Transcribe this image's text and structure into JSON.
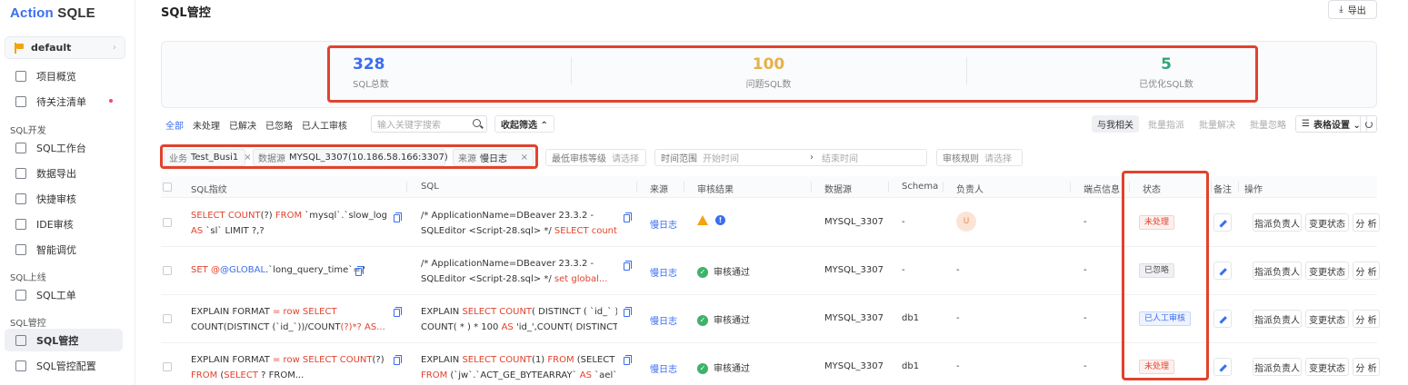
{
  "sidebar": {
    "brand_action": "Action",
    "brand_sqle": "SQLE",
    "project": "default",
    "items": [
      {
        "label": "项目概览"
      },
      {
        "label": "待关注清单"
      },
      {
        "label": "SQL工作台"
      },
      {
        "label": "数据导出"
      },
      {
        "label": "快捷审核"
      },
      {
        "label": "IDE审核"
      },
      {
        "label": "智能调优"
      },
      {
        "label": "SQL工单"
      },
      {
        "label": "SQL管控"
      },
      {
        "label": "SQL管控配置"
      }
    ],
    "groups": [
      "SQL开发",
      "SQL上线",
      "SQL管控"
    ]
  },
  "header": {
    "title": "SQL管控",
    "export_label": "导出"
  },
  "stats": [
    {
      "value": "328",
      "label": "SQL总数",
      "color": "#3a6df0"
    },
    {
      "value": "100",
      "label": "问题SQL数",
      "color": "#e6b14a"
    },
    {
      "value": "5",
      "label": "已优化SQL数",
      "color": "#2fa878"
    }
  ],
  "tabs": [
    "全部",
    "未处理",
    "已解决",
    "已忽略",
    "已人工审核"
  ],
  "search": {
    "placeholder": "输入关键字搜索"
  },
  "collapse_label": "收起筛选 ⌃",
  "tools": {
    "mine": "与我相关",
    "batch_assign": "批量指派",
    "batch_resolve": "批量解决",
    "batch_ignore": "批量忽略",
    "table_settings": "表格设置 ⌄"
  },
  "chips": [
    {
      "key": "业务",
      "value": "Test_Busi1"
    },
    {
      "key": "数据源",
      "value": "MYSQL_3307(10.186.58.166:3307)"
    },
    {
      "key": "来源",
      "value": "慢日志"
    }
  ],
  "filters": {
    "min_level_key": "最低审核等级",
    "min_level_placeholder": "请选择",
    "time_key": "时间范围",
    "time_start": "开始时间",
    "time_end": "结束时间",
    "arrow": "›",
    "rule_key": "审核规则",
    "rule_placeholder": "请选择"
  },
  "columns": {
    "fingerprint": "SQL指纹",
    "sql": "SQL",
    "source": "来源",
    "audit_result": "审核结果",
    "datasource": "数据源",
    "schema": "Schema",
    "owner": "负责人",
    "endpoint": "端点信息",
    "status": "状态",
    "remark": "备注",
    "actions": "操作"
  },
  "rows": [
    {
      "fp1_a": "SELECT COUNT",
      "fp1_b": "(?) ",
      "fp1_c": "FROM",
      "fp1_d": " `mysql`.`slow_log`",
      "fp2_a": "AS",
      "fp2_b": " `sl` LIMIT ?,?",
      "sql1": "/* ApplicationName=DBeaver 23.3.2 -",
      "sql2_a": "SQLEditor <Script-28.sql> */ ",
      "sql2_b": "SELECT count(*)...",
      "source": "慢日志",
      "audit": "",
      "datasource": "MYSQL_3307",
      "schema": "-",
      "owner": "U",
      "endpoint": "-",
      "status": "未处理",
      "status_kind": "red"
    },
    {
      "fp1_a": "SET @",
      "fp1_b": "@GLOBAL",
      "fp1_c": ".`long_query_time`=?",
      "sql1": "/* ApplicationName=DBeaver 23.3.2 -",
      "sql2_a": "SQLEditor <Script-28.sql> */ ",
      "sql2_b": "set global...",
      "source": "慢日志",
      "audit": "审核通过",
      "datasource": "MYSQL_3307",
      "schema": "-",
      "owner": "-",
      "endpoint": "-",
      "status": "已忽略",
      "status_kind": "gray"
    },
    {
      "fp1_a": "EXPLAIN FORMAT ",
      "fp1_b": "= row SELECT",
      "fp2_a": "COUNT",
      "fp2_b": "(DISTINCT (`id_`))/",
      "fp2_c": "COUNT",
      "fp2_d": "(?)*? AS...",
      "sql1_a": "EXPLAIN ",
      "sql1_b": "SELECT COUNT",
      "sql1_c": "( DISTINCT ( `id_` ) ) /",
      "sql2_a": "COUNT",
      "sql2_b": "( * ) * 100 ",
      "sql2_c": "AS",
      "sql2_d": " 'id_',COUNT( DISTINCT (...",
      "source": "慢日志",
      "audit": "审核通过",
      "datasource": "MYSQL_3307",
      "schema": "db1",
      "owner": "-",
      "endpoint": "-",
      "status": "已人工审核",
      "status_kind": "blue"
    },
    {
      "fp1_a": "EXPLAIN FORMAT ",
      "fp1_b": "= row SELECT COUNT",
      "fp1_c": "(?)",
      "fp2_a": "FROM",
      "fp2_b": " (",
      "fp2_c": "SELECT",
      "fp2_d": " ? FROM...",
      "sql1_a": "EXPLAIN ",
      "sql1_b": "SELECT COUNT",
      "sql1_c": "(1) ",
      "sql1_d": "FROM",
      "sql1_e": " (SELECT 1",
      "sql2_a": "FROM",
      "sql2_b": " (`jw`.`ACT_GE_BYTEARRAY` ",
      "sql2_c": "AS",
      "sql2_d": " `ael`)...",
      "source": "慢日志",
      "audit": "审核通过",
      "datasource": "MYSQL_3307",
      "schema": "db1",
      "owner": "-",
      "endpoint": "-",
      "status": "未处理",
      "status_kind": "red"
    }
  ],
  "row_actions": {
    "assign": "指派负责人",
    "change_status": "变更状态",
    "analyze": "分 析"
  },
  "colors": {
    "accent": "#3a6df0",
    "highlight": "#e0432d"
  }
}
